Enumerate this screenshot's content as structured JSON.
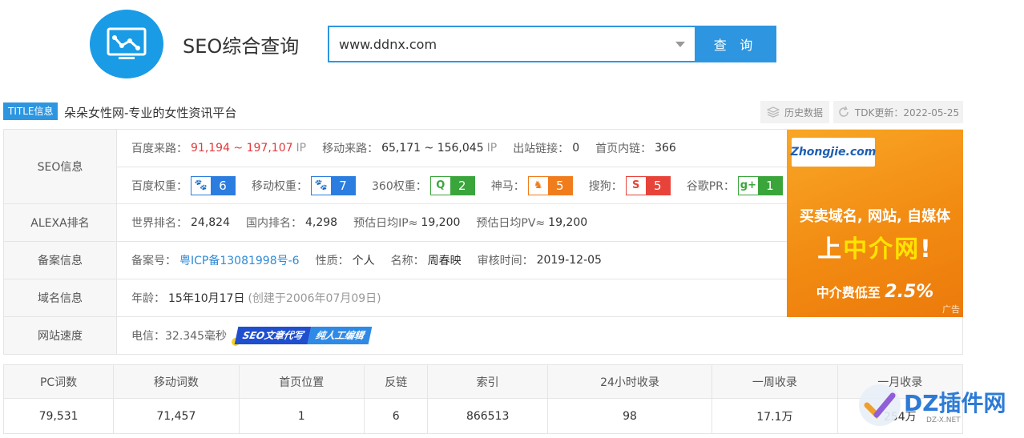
{
  "header": {
    "logo_icon": "chart-monitor-icon",
    "title": "SEO综合查询",
    "search_value": "www.ddnx.com",
    "search_button": "查 询"
  },
  "title_row": {
    "badge": "TITLE信息",
    "site_title": "朵朵女性网-专业的女性资讯平台",
    "history_label": "历史数据",
    "tdk_label": "TDK更新：2022-05-25"
  },
  "seo": {
    "label": "SEO信息",
    "baidu_source_label": "百度来路：",
    "baidu_source_value": "91,194 ~ 197,107",
    "ip": "IP",
    "mobile_source_label": "移动来路：",
    "mobile_source_value": "65,171 ~ 156,045",
    "outlinks_label": "出站链接：",
    "outlinks_value": "0",
    "homepage_links_label": "首页内链：",
    "homepage_links_value": "366",
    "weights": [
      {
        "label": "百度权重：",
        "value": "6",
        "icon": "baidu-paw-icon",
        "color": "#2b7de0",
        "glyph": "🐾"
      },
      {
        "label": "移动权重：",
        "value": "7",
        "icon": "baidu-mobile-paw-icon",
        "color": "#2b7de0",
        "glyph": "🐾"
      },
      {
        "label": "360权重：",
        "value": "2",
        "icon": "360-icon",
        "color": "#3aa53b",
        "glyph": "Q"
      },
      {
        "label": "神马：",
        "value": "5",
        "icon": "shenma-icon",
        "color": "#f07c1c",
        "glyph": "♞"
      },
      {
        "label": "搜狗：",
        "value": "5",
        "icon": "sogou-icon",
        "color": "#e8433a",
        "glyph": "S"
      },
      {
        "label": "谷歌PR：",
        "value": "1",
        "icon": "google-plus-icon",
        "color": "#3aa53b",
        "glyph": "g+"
      }
    ]
  },
  "alexa": {
    "label": "ALEXA排名",
    "world_label": "世界排名：",
    "world_value": "24,824",
    "domestic_label": "国内排名：",
    "domestic_value": "4,298",
    "ip_label": "预估日均IP≈",
    "ip_value": "19,200",
    "pv_label": "预估日均PV≈",
    "pv_value": "19,200"
  },
  "icp": {
    "label": "备案信息",
    "number_label": "备案号：",
    "number_value": "粤ICP备13081998号-6",
    "nature_label": "性质：",
    "nature_value": "个人",
    "name_label": "名称：",
    "name_value": "周春映",
    "review_label": "审核时间：",
    "review_value": "2019-12-05"
  },
  "domain": {
    "label": "域名信息",
    "age_label": "年龄：",
    "age_value": "15年10月17日",
    "created": "(创建于2006年07月09日)"
  },
  "speed": {
    "label": "网站速度",
    "telecom": "电信：32.345毫秒",
    "promo1": "SEO文章代写",
    "promo2": "纯人工编辑"
  },
  "ad": {
    "logo": "Zhongjie.com",
    "line1": "买卖域名, 网站, 自媒体",
    "line2_a": "上",
    "line2_b": "中介网",
    "line2_c": "!",
    "line3": "中介费低至",
    "pct": "2.5%",
    "tag": "广告"
  },
  "stats": {
    "headers": [
      "PC词数",
      "移动词数",
      "首页位置",
      "反链",
      "索引",
      "24小时收录",
      "一周收录",
      "一月收录"
    ],
    "values": [
      "79,531",
      "71,457",
      "1",
      "6",
      "866513",
      "98",
      "17.1万",
      "254万"
    ]
  },
  "watermark": {
    "text": "DZ插件网",
    "sub": "DZ-X.NET"
  }
}
